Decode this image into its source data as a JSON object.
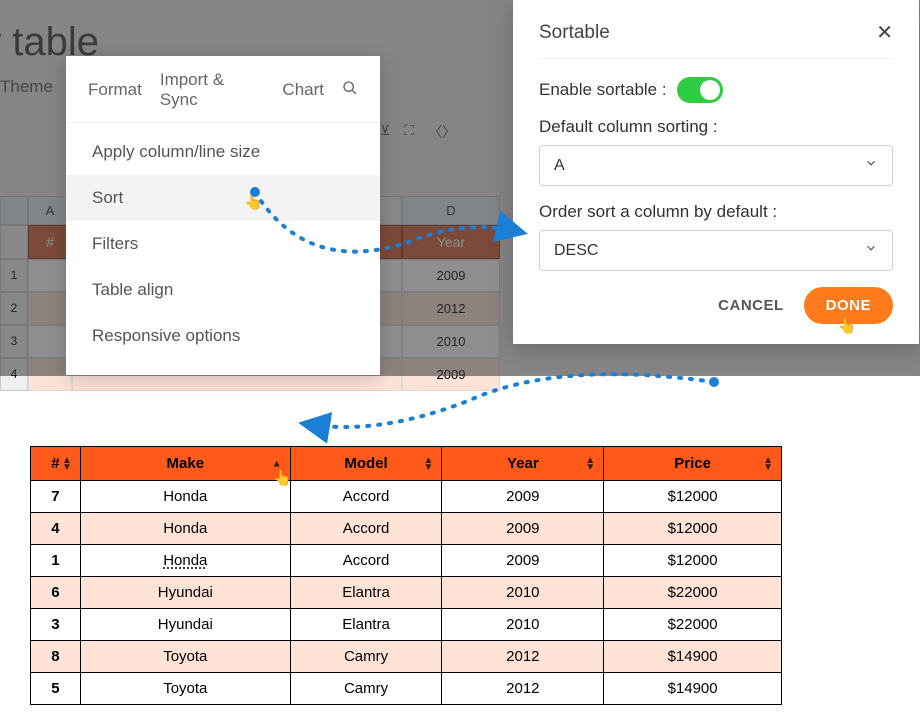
{
  "page": {
    "title_fragment": "ew table",
    "theme_label": "Theme"
  },
  "menu": {
    "tabs": [
      "Format",
      "Import & Sync",
      "Chart"
    ],
    "items": [
      "Apply column/line size",
      "Sort",
      "Filters",
      "Table align",
      "Responsive options"
    ]
  },
  "modal": {
    "title": "Sortable",
    "enable_label": "Enable sortable :",
    "enabled": true,
    "default_col_label": "Default column sorting :",
    "default_col_value": "A",
    "order_label": "Order sort a column by default :",
    "order_value": "DESC",
    "cancel": "CANCEL",
    "done": "DONE"
  },
  "bg_sheet": {
    "col_letters": {
      "a": "A",
      "d": "D"
    },
    "header": {
      "num": "#",
      "year": "Year"
    },
    "rows": [
      {
        "n": 1,
        "year": 2009
      },
      {
        "n": 2,
        "year": 2012
      },
      {
        "n": 3,
        "year": 2010
      },
      {
        "n": 4,
        "year": 2009
      }
    ]
  },
  "result": {
    "headers": {
      "num": "#",
      "make": "Make",
      "model": "Model",
      "year": "Year",
      "price": "Price"
    },
    "rows": [
      {
        "n": 7,
        "make": "Honda",
        "model": "Accord",
        "year": 2009,
        "price": "$12000",
        "tint": false
      },
      {
        "n": 4,
        "make": "Honda",
        "model": "Accord",
        "year": 2009,
        "price": "$12000",
        "tint": true
      },
      {
        "n": 1,
        "make": "Honda",
        "model": "Accord",
        "year": 2009,
        "price": "$12000",
        "tint": false,
        "underline_make": true
      },
      {
        "n": 6,
        "make": "Hyundai",
        "model": "Elantra",
        "year": 2010,
        "price": "$22000",
        "tint": true
      },
      {
        "n": 3,
        "make": "Hyundai",
        "model": "Elantra",
        "year": 2010,
        "price": "$22000",
        "tint": false
      },
      {
        "n": 8,
        "make": "Toyota",
        "model": "Camry",
        "year": 2012,
        "price": "$14900",
        "tint": true
      },
      {
        "n": 5,
        "make": "Toyota",
        "model": "Camry",
        "year": 2012,
        "price": "$14900",
        "tint": false
      }
    ]
  }
}
